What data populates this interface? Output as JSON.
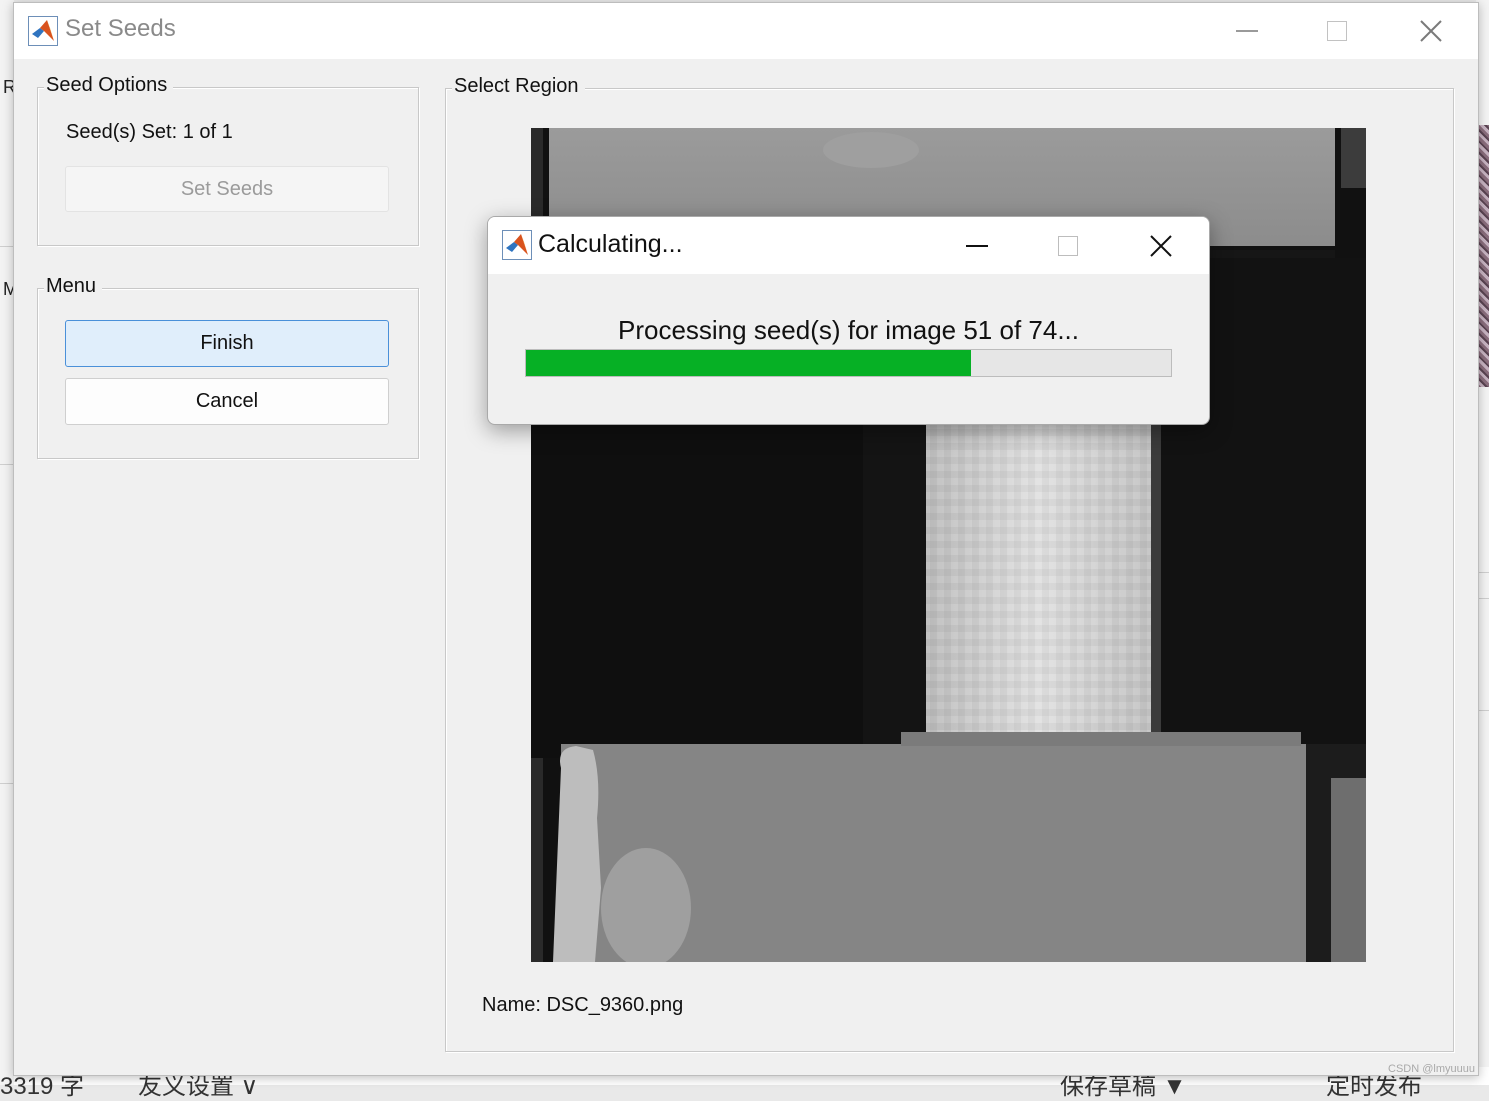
{
  "background": {
    "left_fragments": [
      "R",
      "M"
    ],
    "bottom_texts": [
      "3319 字",
      "友义设置 ∨",
      "保存草稿 ▼",
      "定时发布"
    ],
    "watermark": "CSDN @lmyuuuu"
  },
  "main_window": {
    "title": "Set Seeds",
    "icon": "matlab-icon",
    "controls": [
      "minimize-icon",
      "maximize-icon",
      "close-icon"
    ]
  },
  "seed_options": {
    "legend": "Seed Options",
    "status": "Seed(s) Set: 1 of 1",
    "set_seeds_label": "Set Seeds",
    "set_seeds_enabled": false
  },
  "menu": {
    "legend": "Menu",
    "finish_label": "Finish",
    "cancel_label": "Cancel"
  },
  "select_region": {
    "legend": "Select Region",
    "image_name": "Name: DSC_9360.png"
  },
  "dialog": {
    "title": "Calculating...",
    "icon": "matlab-icon",
    "message": "Processing seed(s) for image 51 of 74...",
    "progress_fraction": 0.6892,
    "progress_color": "#06b025",
    "controls": [
      "minimize-icon",
      "maximize-icon",
      "close-icon"
    ]
  },
  "colors": {
    "window_bg": "#f0f0f0",
    "titlebar_bg": "#ffffff",
    "primary_button_bg": "#e0eefb",
    "primary_button_border": "#4a90d9"
  }
}
